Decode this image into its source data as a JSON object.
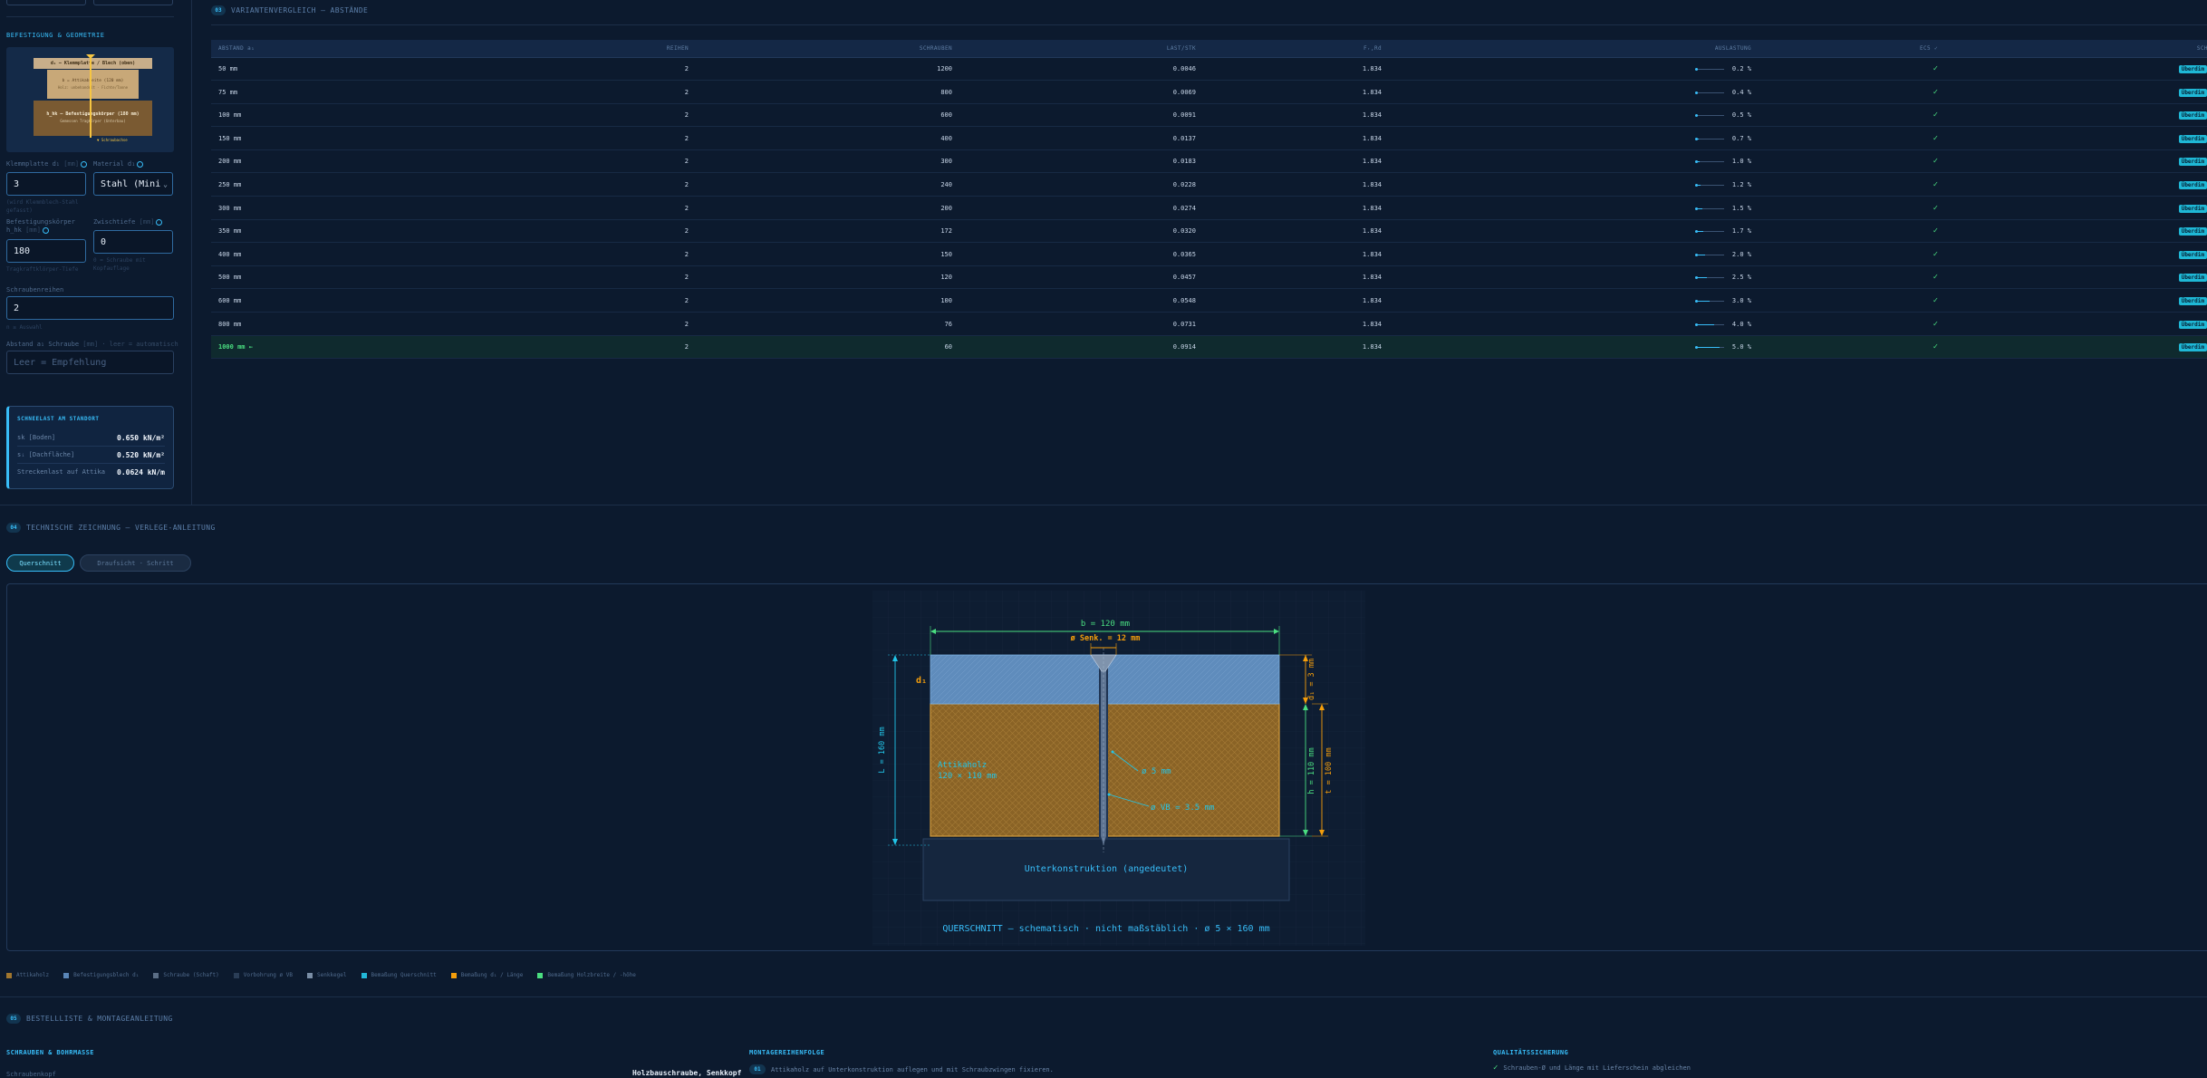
{
  "sidebar": {
    "section_title": "BEFESTIGUNG & GEOMETRIE",
    "thumb": {
      "plate": "d₁ — Klemmplatte / Blech (oben)",
      "body_line1": "b = Attikabreite (120 mm)",
      "body_line2": "Holz: unbehandelt · Fichte/Tanne",
      "base_line1": "h_hk — Befestigungskörper (180 mm)",
      "base_line2": "Gemessen Tragkörper (Unterbau)",
      "foot": "▼ Schraubachse"
    },
    "fields": {
      "klemm_label": "Klemmplatte d₁",
      "klemm_unit": "[mm]",
      "klemm_value": "3",
      "klemm_hint": "(wird Klemmblech-Stahl gefasst)",
      "material_label": "Material d₁",
      "material_value": "Stahl (Mini",
      "body_label_1": "Befestigungskörper",
      "body_label_2": "h_hk",
      "body_unit": "[mm]",
      "body_value": "180",
      "body_hint": "Tragkraftklörper-Tiefe",
      "gap_label": "Zwischtiefe",
      "gap_unit": "[mm]",
      "gap_value": "0",
      "gap_hint": "0 = Schraube mit Kopfauflage",
      "rows_label": "Schraubenreihen",
      "rows_value": "2",
      "rows_hint": "n ≥ Auswahl",
      "spacing_label": "Abstand a₁ Schraube",
      "spacing_unit": "[mm] · leer = automatisch",
      "spacing_placeholder": "Leer = Empfehlung"
    },
    "wind": {
      "title": "SCHNEELAST AM STANDORT",
      "rows": [
        {
          "k": "sk [Boden]",
          "v": "0.650 kN/m²"
        },
        {
          "k": "sᵢ [Dachfläche]",
          "v": "0.520 kN/m²"
        },
        {
          "k": "Streckenlast auf Attika",
          "v": "0.0624 kN/m"
        }
      ]
    }
  },
  "variants": {
    "badge": "03",
    "title": "VARIANTENVERGLEICH — ABSTÄNDE",
    "headers": [
      "ABSTAND a₁",
      "REIHEN",
      "SCHRAUBEN",
      "LAST/STK",
      "Fᵣ,Rd",
      "AUSLASTUNG",
      "EC5 ✓",
      "SCHRITT"
    ],
    "rows": [
      {
        "a": "50 mm",
        "reihen": "2",
        "schrauben": "1200",
        "last": "0.0046",
        "frd": "1.834",
        "ausl": "0.2 %",
        "ausl_pct": 0.2,
        "ok": "✓",
        "tag": "Überdim"
      },
      {
        "a": "75 mm",
        "reihen": "2",
        "schrauben": "800",
        "last": "0.0069",
        "frd": "1.834",
        "ausl": "0.4 %",
        "ausl_pct": 0.4,
        "ok": "✓",
        "tag": "Überdim"
      },
      {
        "a": "100 mm",
        "reihen": "2",
        "schrauben": "600",
        "last": "0.0091",
        "frd": "1.834",
        "ausl": "0.5 %",
        "ausl_pct": 0.5,
        "ok": "✓",
        "tag": "Überdim"
      },
      {
        "a": "150 mm",
        "reihen": "2",
        "schrauben": "400",
        "last": "0.0137",
        "frd": "1.834",
        "ausl": "0.7 %",
        "ausl_pct": 0.7,
        "ok": "✓",
        "tag": "Überdim"
      },
      {
        "a": "200 mm",
        "reihen": "2",
        "schrauben": "300",
        "last": "0.0183",
        "frd": "1.834",
        "ausl": "1.0 %",
        "ausl_pct": 1.0,
        "ok": "✓",
        "tag": "Überdim"
      },
      {
        "a": "250 mm",
        "reihen": "2",
        "schrauben": "240",
        "last": "0.0228",
        "frd": "1.834",
        "ausl": "1.2 %",
        "ausl_pct": 1.2,
        "ok": "✓",
        "tag": "Überdim"
      },
      {
        "a": "300 mm",
        "reihen": "2",
        "schrauben": "200",
        "last": "0.0274",
        "frd": "1.834",
        "ausl": "1.5 %",
        "ausl_pct": 1.5,
        "ok": "✓",
        "tag": "Überdim"
      },
      {
        "a": "350 mm",
        "reihen": "2",
        "schrauben": "172",
        "last": "0.0320",
        "frd": "1.834",
        "ausl": "1.7 %",
        "ausl_pct": 1.7,
        "ok": "✓",
        "tag": "Überdim"
      },
      {
        "a": "400 mm",
        "reihen": "2",
        "schrauben": "150",
        "last": "0.0365",
        "frd": "1.834",
        "ausl": "2.0 %",
        "ausl_pct": 2.0,
        "ok": "✓",
        "tag": "Überdim"
      },
      {
        "a": "500 mm",
        "reihen": "2",
        "schrauben": "120",
        "last": "0.0457",
        "frd": "1.834",
        "ausl": "2.5 %",
        "ausl_pct": 2.5,
        "ok": "✓",
        "tag": "Überdim"
      },
      {
        "a": "600 mm",
        "reihen": "2",
        "schrauben": "100",
        "last": "0.0548",
        "frd": "1.834",
        "ausl": "3.0 %",
        "ausl_pct": 3.0,
        "ok": "✓",
        "tag": "Überdim"
      },
      {
        "a": "800 mm",
        "reihen": "2",
        "schrauben": "76",
        "last": "0.0731",
        "frd": "1.834",
        "ausl": "4.0 %",
        "ausl_pct": 4.0,
        "ok": "✓",
        "tag": "Überdim"
      },
      {
        "a": "1000 mm ←",
        "reihen": "2",
        "schrauben": "60",
        "last": "0.0914",
        "frd": "1.834",
        "ausl": "5.0 %",
        "ausl_pct": 5.0,
        "ok": "✓",
        "tag": "Überdim"
      }
    ]
  },
  "drawing": {
    "badge": "04",
    "title": "TECHNISCHE ZEICHNUNG — VERLEGE-ANLEITUNG",
    "tabs": [
      "Querschnitt",
      "Draufsicht · Schritt"
    ],
    "dim_b": "b = 120 mm",
    "dim_senk": "ø Senk. = 12 mm",
    "label_d1": "d₁",
    "dim_L": "L = 160 mm",
    "wood_label_1": "Attikaholz",
    "wood_label_2": "120 × 110 mm",
    "screw_d": "ø 5 mm",
    "screw_vb": "ø VB = 3.5 mm",
    "dim_d1": "d₁ = 3 mm",
    "dim_h": "h = 110 mm",
    "dim_t": "t = 100 mm",
    "sub_label": "Unterkonstruktion (angedeutet)",
    "caption": "QUERSCHNITT — schematisch · nicht maßstäblich · ø 5 × 160 mm"
  },
  "legend": [
    {
      "label": "Attikaholz",
      "color": "#a0762e"
    },
    {
      "label": "Befestigungsblech d₁",
      "color": "#5a86b8"
    },
    {
      "label": "Schraube (Schaft)",
      "color": "#5b6e86"
    },
    {
      "label": "Vorbohrung ø VB",
      "color": "#2a3d56"
    },
    {
      "label": "Senkkegel",
      "color": "#7a8ea6"
    },
    {
      "label": "Bemaßung Querschnitt",
      "color": "#22b8d8"
    },
    {
      "label": "Bemaßung d₁ / Länge",
      "color": "#f59e0b"
    },
    {
      "label": "Bemaßung Holzbreite / -höhe",
      "color": "#4ade80"
    }
  ],
  "order": {
    "badge": "05",
    "title": "BESTELLLISTE & MONTAGEANLEITUNG",
    "col1_title": "SCHRAUBEN & BOHRMASSE",
    "col1_row_k": "Schraubenkopf",
    "col1_row_v": "Holzbauschraube, Senkkopf",
    "col2_title": "MONTAGEREIHENFOLGE",
    "col2_step_no": "01",
    "col2_step": "Attikaholz auf Unterkonstruktion auflegen und mit Schraubzwingen fixieren.",
    "col3_title": "QUALITÄTSSICHERUNG",
    "col3_item": "Schrauben-Ø und Länge mit Lieferschein abgleichen"
  }
}
